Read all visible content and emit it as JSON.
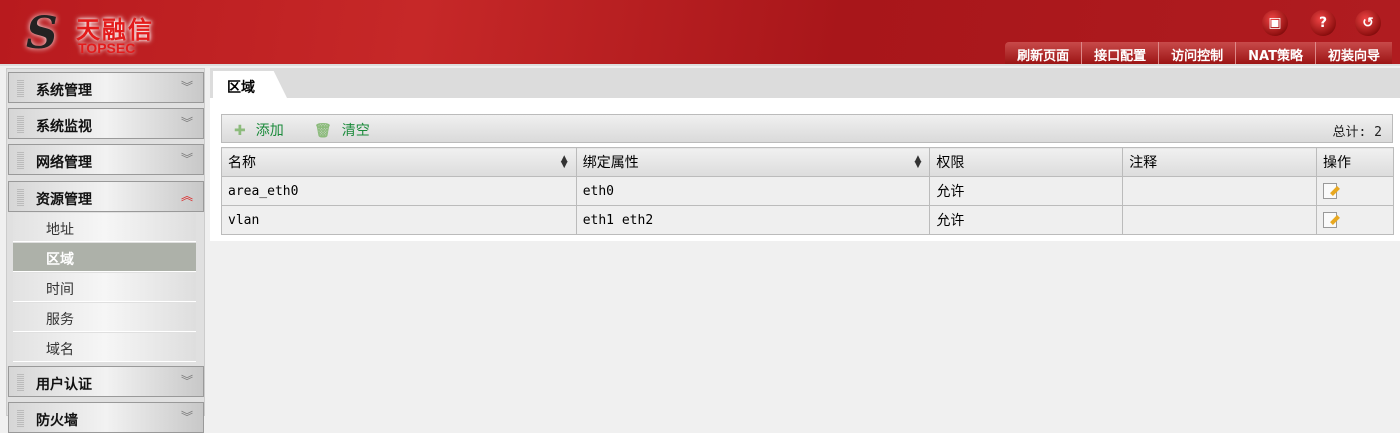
{
  "brand": {
    "logo_cn": "天融信",
    "logo_en": "TOPSEC"
  },
  "header_icons": [
    "save-icon",
    "help-icon",
    "logout-icon"
  ],
  "topnav": [
    "刷新页面",
    "接口配置",
    "访问控制",
    "NAT策略",
    "初装向导"
  ],
  "sidebar": {
    "groups": [
      {
        "label": "系统管理",
        "open": false
      },
      {
        "label": "系统监视",
        "open": false
      },
      {
        "label": "网络管理",
        "open": false
      },
      {
        "label": "资源管理",
        "open": true
      },
      {
        "label": "用户认证",
        "open": false
      },
      {
        "label": "防火墙",
        "open": false
      }
    ],
    "sub_items": [
      {
        "label": "地址",
        "selected": false
      },
      {
        "label": "区域",
        "selected": true
      },
      {
        "label": "时间",
        "selected": false
      },
      {
        "label": "服务",
        "selected": false
      },
      {
        "label": "域名",
        "selected": false
      }
    ]
  },
  "tab": "区域",
  "toolbar": {
    "add": "添加",
    "clear": "清空",
    "total": "总计: 2"
  },
  "table": {
    "columns": [
      "名称",
      "绑定属性",
      "权限",
      "注释",
      "操作"
    ],
    "rows": [
      {
        "name": "area_eth0",
        "binding": "eth0",
        "permission": "允许",
        "comment": ""
      },
      {
        "name": "vlan",
        "binding": "eth1 eth2",
        "permission": "允许",
        "comment": ""
      }
    ]
  }
}
